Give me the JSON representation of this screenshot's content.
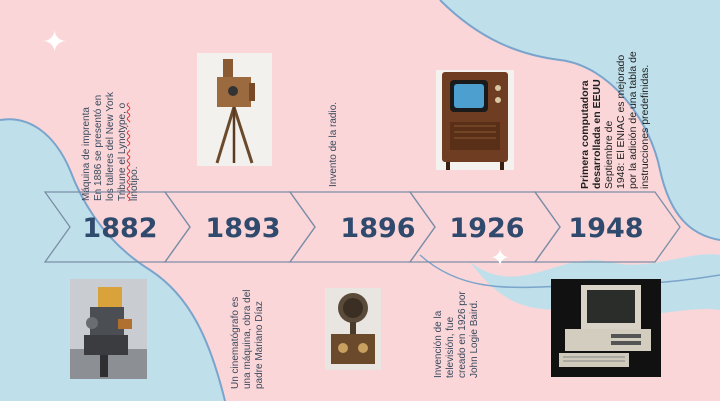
{
  "colors": {
    "background_pink": "#fbd6d8",
    "blob_blue": "#bfe0ea",
    "blob_outline": "#7aa4cc",
    "arrow_stroke": "#7b8ea8",
    "year_text": "#2f4a6d"
  },
  "timeline": {
    "years": [
      "1882",
      "1893",
      "1896",
      "1926",
      "1948"
    ]
  },
  "events": {
    "e1882": {
      "lines": [
        "Máquina de imprenta",
        "En 1886 se presentó en",
        "los talleres del New York",
        "Tribune el Lynotype, o",
        "linotipo."
      ]
    },
    "e1893": {
      "lines": [
        "Un cinematógrafo es",
        "una máquina, obra del",
        "padre Mariano Díaz"
      ]
    },
    "e1896": {
      "lines": [
        "Invento de la radio."
      ]
    },
    "e1926": {
      "lines": [
        "Invención de la",
        "televisión, fue",
        "creado en 1926 por",
        "John Logie Baird."
      ]
    },
    "e1948": {
      "title_lines": [
        "Primera computadora",
        "desarrollada en EEUU"
      ],
      "lines": [
        "Septiembre de",
        "1948: El ENIAC es mejorado",
        "por la adición de una tabla de",
        "instrucciones predefinidas."
      ]
    }
  },
  "images": {
    "linotype": "linotype-photo",
    "cinematograph": "cinematograph-photo",
    "radio": "radio-photo",
    "television": "television-photo",
    "computer": "computer-photo"
  }
}
